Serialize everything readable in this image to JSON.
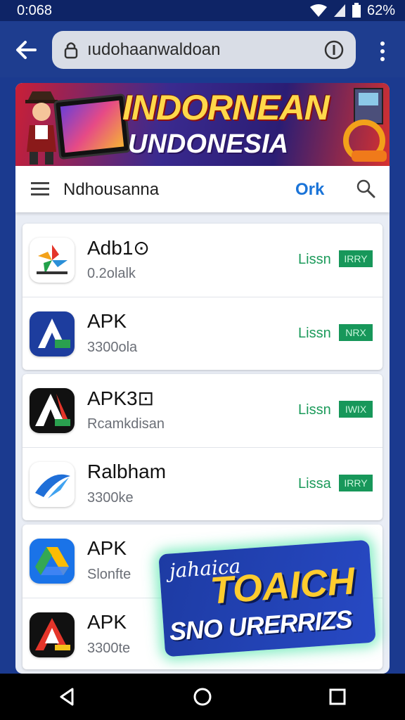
{
  "status_bar": {
    "time": "0:068",
    "battery": "62%"
  },
  "browser": {
    "url": "ıudohaanwaldoan"
  },
  "banner": {
    "title_line1": "INDORNEAN",
    "title_line2": "UNDONESIA"
  },
  "header": {
    "title": "Ndhousanna",
    "action_label": "Ork"
  },
  "apps": [
    {
      "name": "Adb1⊙",
      "subtitle": "0.2olalk",
      "use_label": "Lissn",
      "tag": "IRRY",
      "icon": "pinwheel-app-icon"
    },
    {
      "name": "APK",
      "subtitle": "3300ola",
      "use_label": "Lissn",
      "tag": "NRX",
      "icon": "blue-a-app-icon"
    },
    {
      "name": "APK3⊡",
      "subtitle": "Rcamkdisan",
      "use_label": "Lissn",
      "tag": "IWIX",
      "icon": "black-a-app-icon"
    },
    {
      "name": "Ralbham",
      "subtitle": "3300ke",
      "use_label": "Lissa",
      "tag": "IRRY",
      "icon": "swirl-app-icon"
    },
    {
      "name": "APK",
      "subtitle": "Slonfte",
      "use_label": "",
      "tag": "",
      "icon": "drive-app-icon"
    },
    {
      "name": "APK",
      "subtitle": "3300te",
      "use_label": "",
      "tag": "",
      "icon": "red-a-app-icon"
    }
  ],
  "promo": {
    "small_text": "jahaica",
    "big_text": "TOAICH",
    "line_text": "SNO URERRIZS"
  },
  "colors": {
    "accent": "#1b74d8",
    "green": "#17975a",
    "browser_bar": "#1e3d8f"
  }
}
